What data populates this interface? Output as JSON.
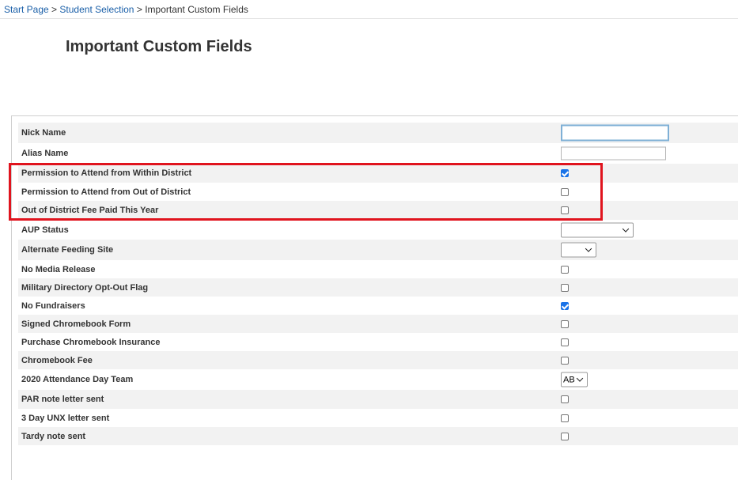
{
  "breadcrumb": {
    "items": [
      "Start Page",
      "Student Selection",
      "Important Custom Fields"
    ],
    "separator": ">"
  },
  "page_title": "Important Custom Fields",
  "fields": [
    {
      "label": "Nick Name",
      "control": "text",
      "value": ""
    },
    {
      "label": "Alias Name",
      "control": "text",
      "value": ""
    },
    {
      "label": "Permission to Attend from Within District",
      "control": "checkbox",
      "checked": true
    },
    {
      "label": "Permission to Attend from Out of District",
      "control": "checkbox",
      "checked": false
    },
    {
      "label": "Out of District Fee Paid This Year",
      "control": "checkbox",
      "checked": false
    },
    {
      "label": "AUP Status",
      "control": "select",
      "value": ""
    },
    {
      "label": "Alternate Feeding Site",
      "control": "select",
      "value": ""
    },
    {
      "label": "No Media Release",
      "control": "checkbox",
      "checked": false
    },
    {
      "label": "Military Directory Opt-Out Flag",
      "control": "checkbox",
      "checked": false
    },
    {
      "label": "No Fundraisers",
      "control": "checkbox",
      "checked": true
    },
    {
      "label": "Signed Chromebook Form",
      "control": "checkbox",
      "checked": false
    },
    {
      "label": "Purchase Chromebook Insurance",
      "control": "checkbox",
      "checked": false
    },
    {
      "label": "Chromebook Fee",
      "control": "checkbox",
      "checked": false
    },
    {
      "label": "2020 Attendance Day Team",
      "control": "select",
      "value": "AB"
    },
    {
      "label": "PAR note letter sent",
      "control": "checkbox",
      "checked": false
    },
    {
      "label": "3 Day UNX letter sent",
      "control": "checkbox",
      "checked": false
    },
    {
      "label": "Tardy note sent",
      "control": "checkbox",
      "checked": false
    }
  ],
  "colors": {
    "link": "#1a5fa8",
    "highlight_border": "#e0141e",
    "checkbox_checked": "#1a73e8",
    "row_shade": "#f2f2f2"
  }
}
